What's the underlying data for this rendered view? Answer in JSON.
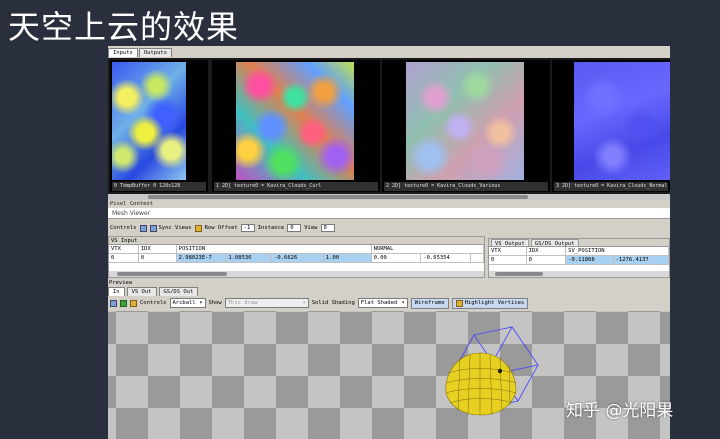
{
  "slide_title": "天空上云的效果",
  "watermark": "知乎 @光阳果",
  "texture_tabs": [
    "Inputs",
    "Outputs"
  ],
  "thumbnails": [
    {
      "caption": "0 TempBuffer 0 128x128",
      "palette": "blue-yellow-noise"
    },
    {
      "caption": "1 2D] texture0 = Kavira_Clouds_Curl",
      "palette": "rainbow-noise"
    },
    {
      "caption": "2 2D] texture0 = Kavira_Clouds_Various",
      "palette": "pastel-noise"
    },
    {
      "caption": "3 2D] texture0 = Kavira_Clouds_Normal",
      "palette": "normal-map"
    }
  ],
  "section_label": "Pixel Context",
  "mesh_viewer_title": "Mesh Viewer",
  "toolbar": {
    "controls_label": "Controls",
    "sync_views": "Sync Views",
    "row_offset_label": "Row Offset",
    "row_offset_value": "-1",
    "instance_label": "Instance",
    "instance_value": "0",
    "view_label": "View",
    "view_value": "0"
  },
  "vs_input": {
    "title": "VS Input",
    "columns": [
      "VTX",
      "IDX",
      "POSITION",
      "",
      "",
      "",
      "NORMAL",
      "",
      ""
    ],
    "row": [
      "0",
      "0",
      "2.98023E-7",
      "1.08536",
      "-0.6626",
      "1.00",
      "0.00",
      "-0.65354",
      ""
    ]
  },
  "vs_output": {
    "tabs": [
      "VS Output",
      "GS/DS Output"
    ],
    "columns": [
      "VTX",
      "IDX",
      "SV_POSITION",
      ""
    ],
    "row": [
      "0",
      "0",
      "-0.11808",
      "-1276.4137"
    ]
  },
  "preview_label": "Preview",
  "preview_tabs": [
    "In",
    "VS Out",
    "GS/DS Out"
  ],
  "preview_toolbar": {
    "controls_label": "Controls",
    "controls_value": "Arcball",
    "show_label": "Show",
    "show_value": "This draw",
    "solid_shading_label": "Solid Shading",
    "solid_shading_value": "Flat Shaded",
    "wireframe_label": "Wireframe",
    "highlight_label": "Highlight Vertices"
  },
  "colors": {
    "slide_bg": "#2a2f3d",
    "panel_bg": "#d4d0c8",
    "selection": "#a8d0f0",
    "mesh_fill": "#e8d020",
    "wire_color": "#4040ff"
  }
}
